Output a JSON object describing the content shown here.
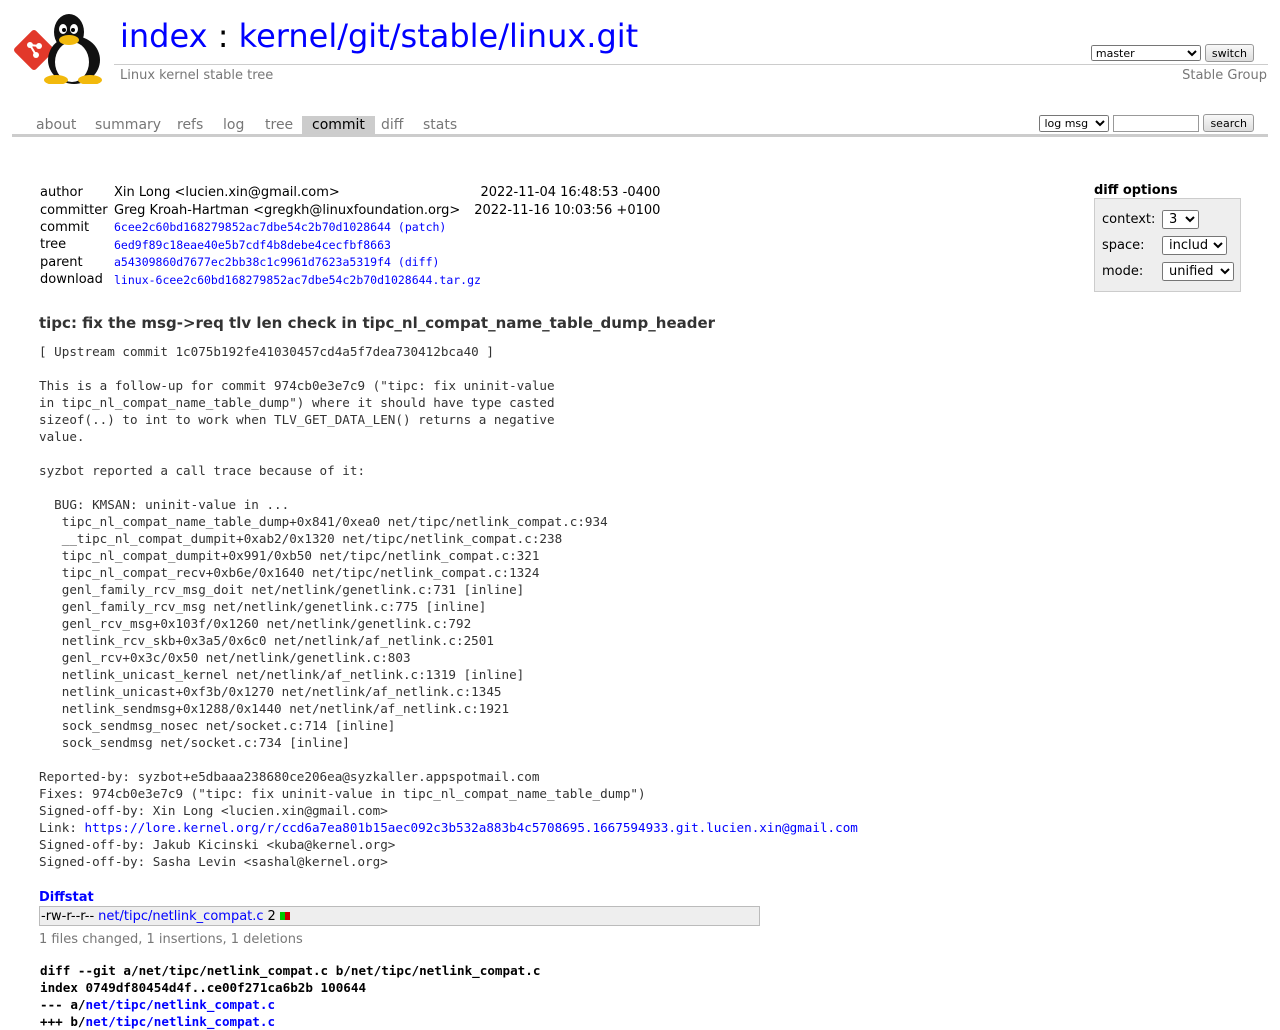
{
  "header": {
    "title_index": "index",
    "title_sep": " : ",
    "title_repo": "kernel/git/stable/linux.git",
    "description": "Linux kernel stable tree",
    "owner": "Stable Group",
    "branch_selected": "master",
    "switch_label": "switch"
  },
  "tabs": [
    {
      "label": "about"
    },
    {
      "label": "summary"
    },
    {
      "label": "refs"
    },
    {
      "label": "log"
    },
    {
      "label": "tree"
    },
    {
      "label": "commit"
    },
    {
      "label": "diff"
    },
    {
      "label": "stats"
    }
  ],
  "search": {
    "grep_selected": "log msg",
    "search_value": "",
    "search_label": "search"
  },
  "commit_info": {
    "author_label": "author",
    "author": "Xin Long <lucien.xin@gmail.com>",
    "author_date": "2022-11-04 16:48:53 -0400",
    "committer_label": "committer",
    "committer": "Greg Kroah-Hartman <gregkh@linuxfoundation.org>",
    "committer_date": "2022-11-16 10:03:56 +0100",
    "commit_label": "commit",
    "commit_sha": "6cee2c60bd168279852ac7dbe54c2b70d1028644",
    "commit_patch": "(patch)",
    "tree_label": "tree",
    "tree_sha": "6ed9f89c18eae40e5b7cdf4b8debe4cecfbf8663",
    "parent_label": "parent",
    "parent_sha": "a54309860d7677ec2bb38c1c9961d7623a5319f4",
    "parent_diff": "(diff)",
    "download_label": "download",
    "download_link": "linux-6cee2c60bd168279852ac7dbe54c2b70d1028644.tar.gz"
  },
  "diff_options": {
    "title": "diff options",
    "context_label": "context:",
    "context_value": "3",
    "space_label": "space:",
    "space_value": "include",
    "mode_label": "mode:",
    "mode_value": "unified"
  },
  "subject": "tipc: fix the msg->req tlv len check in tipc_nl_compat_name_table_dump_header",
  "message_before_link": "[ Upstream commit 1c075b192fe41030457cd4a5f7dea730412bca40 ]\n\nThis is a follow-up for commit 974cb0e3e7c9 (\"tipc: fix uninit-value\nin tipc_nl_compat_name_table_dump\") where it should have type casted\nsizeof(..) to int to work when TLV_GET_DATA_LEN() returns a negative\nvalue.\n\nsyzbot reported a call trace because of it:\n\n  BUG: KMSAN: uninit-value in ...\n   tipc_nl_compat_name_table_dump+0x841/0xea0 net/tipc/netlink_compat.c:934\n   __tipc_nl_compat_dumpit+0xab2/0x1320 net/tipc/netlink_compat.c:238\n   tipc_nl_compat_dumpit+0x991/0xb50 net/tipc/netlink_compat.c:321\n   tipc_nl_compat_recv+0xb6e/0x1640 net/tipc/netlink_compat.c:1324\n   genl_family_rcv_msg_doit net/netlink/genetlink.c:731 [inline]\n   genl_family_rcv_msg net/netlink/genetlink.c:775 [inline]\n   genl_rcv_msg+0x103f/0x1260 net/netlink/genetlink.c:792\n   netlink_rcv_skb+0x3a5/0x6c0 net/netlink/af_netlink.c:2501\n   genl_rcv+0x3c/0x50 net/netlink/genetlink.c:803\n   netlink_unicast_kernel net/netlink/af_netlink.c:1319 [inline]\n   netlink_unicast+0xf3b/0x1270 net/netlink/af_netlink.c:1345\n   netlink_sendmsg+0x1288/0x1440 net/netlink/af_netlink.c:1921\n   sock_sendmsg_nosec net/socket.c:714 [inline]\n   sock_sendmsg net/socket.c:734 [inline]\n\nReported-by: syzbot+e5dbaaa238680ce206ea@syzkaller.appspotmail.com\nFixes: 974cb0e3e7c9 (\"tipc: fix uninit-value in tipc_nl_compat_name_table_dump\")\nSigned-off-by: Xin Long <lucien.xin@gmail.com>\nLink: ",
  "message_link": "https://lore.kernel.org/r/ccd6a7ea801b15aec092c3b532a883b4c5708695.1667594933.git.lucien.xin@gmail.com",
  "message_after_link": "\nSigned-off-by: Jakub Kicinski <kuba@kernel.org>\nSigned-off-by: Sasha Levin <sashal@kernel.org>",
  "diffstat": {
    "title": "Diffstat",
    "mode": "-rw-r--r--",
    "path": "net/tipc/netlink_compat.c",
    "count": "2",
    "add_color": "#0c0",
    "del_color": "#c00",
    "summary": "1 files changed, 1 insertions, 1 deletions"
  },
  "diff": {
    "line1": "diff --git a/net/tipc/netlink_compat.c b/net/tipc/netlink_compat.c",
    "line2": "index 0749df80454d4f..ce00f271ca6b2b 100644",
    "line3_prefix": "--- a/",
    "line3_path": "net/tipc/netlink_compat.c",
    "line4_prefix": "+++ b/",
    "line4_path": "net/tipc/netlink_compat.c"
  }
}
